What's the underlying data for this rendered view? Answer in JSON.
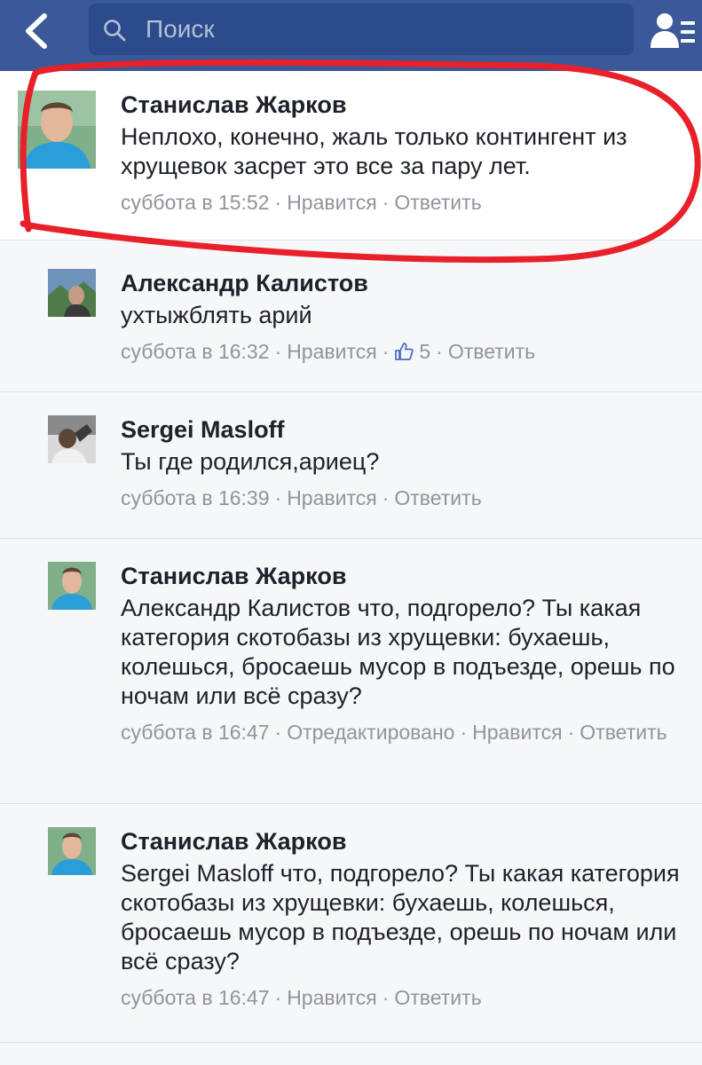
{
  "header": {
    "search_placeholder": "Поиск"
  },
  "comments": [
    {
      "author": "Станислав Жарков",
      "text": "Неплохо, конечно, жаль только контингент из хрущевок засрет это все за пару лет.",
      "time": "суббота в 15:52",
      "like": "Нравится",
      "reply": "Ответить"
    },
    {
      "author": "Александр Калистов",
      "text": "ухтыжблять арий",
      "time": "суббота в 16:32",
      "like": "Нравится",
      "like_count": "5",
      "reply": "Ответить"
    },
    {
      "author": "Sergei Masloff",
      "text": "Ты где родился,ариец?",
      "time": "суббота в 16:39",
      "like": "Нравится",
      "reply": "Ответить"
    },
    {
      "author": "Станислав Жарков",
      "text": "Александр Калистов что, подгорело? Ты какая категория скотобазы из хрущевки: бухаешь, колешься, бросаешь мусор в подъезде, орешь по ночам или всё сразу?",
      "time": "суббота в 16:47",
      "edited": "Отредактировано",
      "like": "Нравится",
      "reply": "Ответить"
    },
    {
      "author": "Станислав Жарков",
      "text": "Sergei Masloff что, подгорело? Ты какая категория скотобазы из хрущевки: бухаешь, колешься, бросаешь мусор в подъезде, орешь по ночам или всё сразу?",
      "time": "суббота в 16:47",
      "like": "Нравится",
      "reply": "Ответить"
    }
  ],
  "colors": {
    "header_bg": "#3b5998",
    "search_bg": "#2b4b8c",
    "annotation_red": "#e8202a",
    "meta_gray": "#90949c"
  },
  "icons": {
    "back": "chevron-left-icon",
    "search": "search-icon",
    "friends": "friend-requests-icon",
    "like_count": "thumbs-up-icon"
  }
}
